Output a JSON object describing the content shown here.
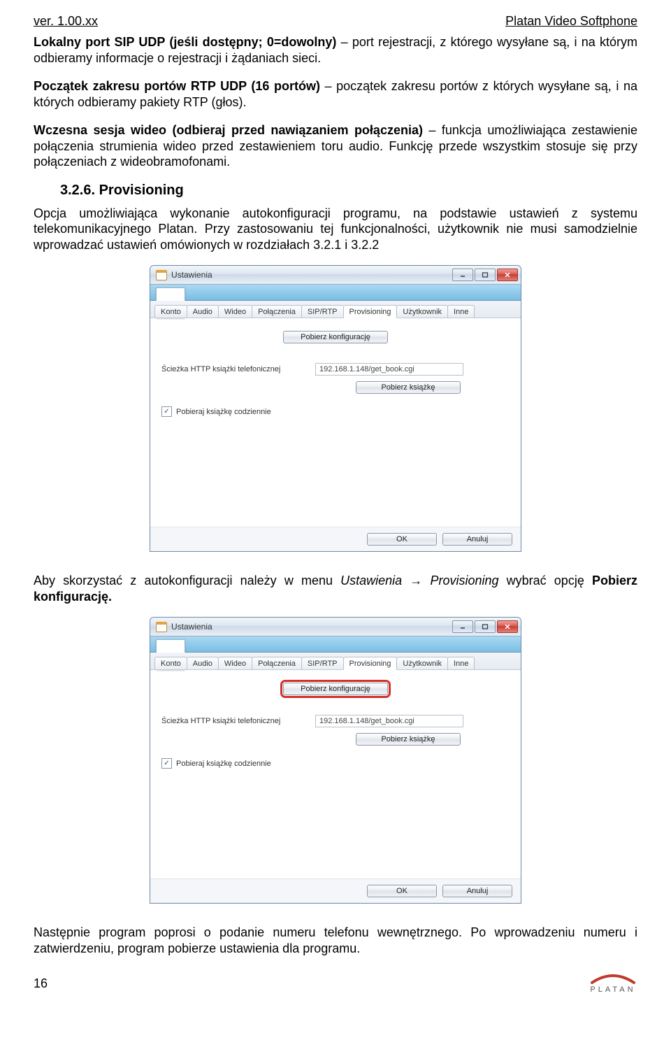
{
  "header": {
    "version": "ver. 1.00.xx",
    "product": "Platan Video Softphone"
  },
  "paragraphs": {
    "p1_bold": "Lokalny port SIP UDP (jeśli dostępny; 0=dowolny)",
    "p1_rest": " – port rejestracji, z którego wysyłane są, i na którym odbieramy informacje o rejestracji i żądaniach sieci.",
    "p2_bold": "Początek zakresu portów RTP UDP (16 portów)",
    "p2_rest": " – początek zakresu portów z których wysyłane są, i na których odbieramy pakiety RTP (głos).",
    "p3_bold": "Wczesna sesja wideo (odbieraj przed nawiązaniem połączenia)",
    "p3_rest": " – funkcja umożliwiająca zestawienie połączenia strumienia wideo przed zestawieniem toru audio. Funkcję przede wszystkim stosuje się przy połączeniach z wideobramofonami.",
    "heading": "3.2.6. Provisioning",
    "p4": "Opcja umożliwiająca wykonanie autokonfiguracji programu, na podstawie ustawień z systemu telekomunikacyjnego Platan. Przy zastosowaniu tej funkcjonalności, użytkownik nie musi samodzielnie wprowadzać ustawień omówionych w rozdziałach 3.2.1 i 3.2.2",
    "p5_a": "Aby skorzystać z autokonfiguracji należy w menu ",
    "p5_i1": "Ustawienia",
    "p5_arrow": " → ",
    "p5_i2": "Provisioning",
    "p5_b": " wybrać opcję ",
    "p5_bold": "Pobierz konfigurację.",
    "p6": "Następnie program poprosi o podanie numeru telefonu wewnętrznego. Po wprowadzeniu numeru i zatwierdzeniu, program pobierze ustawienia dla programu."
  },
  "dialog": {
    "title": "Ustawienia",
    "tabs": [
      "Konto",
      "Audio",
      "Wideo",
      "Połączenia",
      "SIP/RTP",
      "Provisioning",
      "Użytkownik",
      "Inne"
    ],
    "btn_pobierz_konf": "Pobierz konfigurację",
    "label_path": "Ścieżka HTTP książki telefonicznej",
    "path_value": "192.168.1.148/get_book.cgi",
    "btn_pobierz_ksiazke": "Pobierz książkę",
    "checkbox_label": "Pobieraj książkę codziennie",
    "ok": "OK",
    "cancel": "Anuluj"
  },
  "footer": {
    "page": "16",
    "brand": "PLATAN"
  }
}
